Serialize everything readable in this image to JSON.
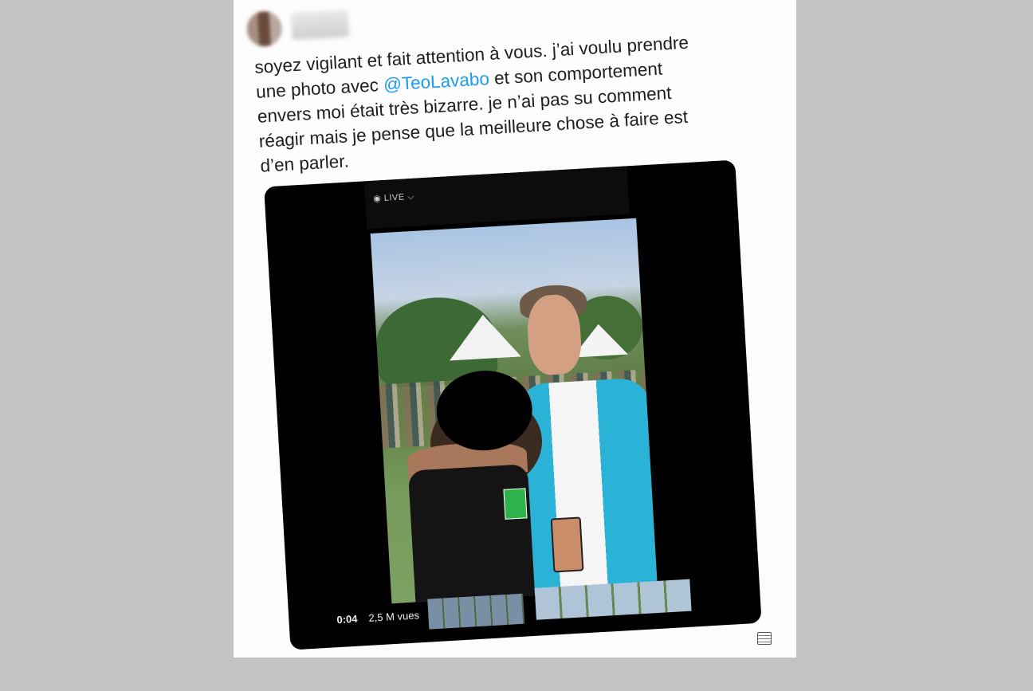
{
  "tweet": {
    "text_before_mention": "soyez vigilant et fait attention à vous. j’ai voulu prendre\nune photo avec ",
    "mention": "@TeoLavabo",
    "text_after_mention": " et son comportement\nenvers moi était très bizarre. je n’ai pas su comment\nréagir mais je pense que la meilleure chose à faire est\nd’en parler."
  },
  "media": {
    "live_label": "◉ LIVE ⌵",
    "time": "0:04",
    "views": "2,5 M vues"
  },
  "colors": {
    "mention": "#1d9bf0",
    "media_bg": "#000000",
    "page_bg": "#c4c4c4"
  }
}
